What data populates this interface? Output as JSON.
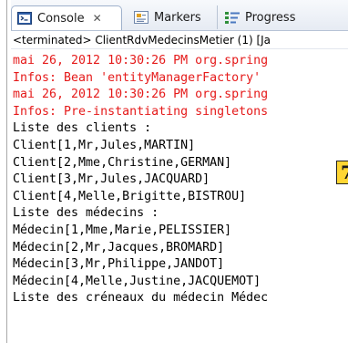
{
  "tabs": {
    "console_label": "Console",
    "console_close": "✕",
    "markers_label": "Markers",
    "progress_label": "Progress"
  },
  "status_line": "<terminated> ClientRdvMedecinsMetier (1) [Ja",
  "console_lines": [
    {
      "text": "mai 26, 2012 10:30:26 PM org.spring",
      "stream": "err"
    },
    {
      "text": "Infos: Bean 'entityManagerFactory'",
      "stream": "err"
    },
    {
      "text": "mai 26, 2012 10:30:26 PM org.spring",
      "stream": "err"
    },
    {
      "text": "Infos: Pre-instantiating singletons",
      "stream": "err"
    },
    {
      "text": "Liste des clients :",
      "stream": "out"
    },
    {
      "text": "Client[1,Mr,Jules,MARTIN]",
      "stream": "out"
    },
    {
      "text": "Client[2,Mme,Christine,GERMAN]",
      "stream": "out"
    },
    {
      "text": "Client[3,Mr,Jules,JACQUARD]",
      "stream": "out"
    },
    {
      "text": "Client[4,Melle,Brigitte,BISTROU]",
      "stream": "out"
    },
    {
      "text": "Liste des médecins :",
      "stream": "out"
    },
    {
      "text": "Médecin[1,Mme,Marie,PELISSIER]",
      "stream": "out"
    },
    {
      "text": "Médecin[2,Mr,Jacques,BROMARD]",
      "stream": "out"
    },
    {
      "text": "Médecin[3,Mr,Philippe,JANDOT]",
      "stream": "out"
    },
    {
      "text": "Médecin[4,Melle,Justine,JACQUEMOT]",
      "stream": "out"
    },
    {
      "text": "Liste des créneaux du médecin Médec",
      "stream": "out"
    }
  ],
  "badge_label": "7",
  "colors": {
    "stderr": "#e51a1a",
    "stdout": "#000000",
    "badge_bg": "#ffd633"
  },
  "icons": {
    "console": "console-icon",
    "markers": "markers-icon",
    "progress": "progress-icon"
  }
}
